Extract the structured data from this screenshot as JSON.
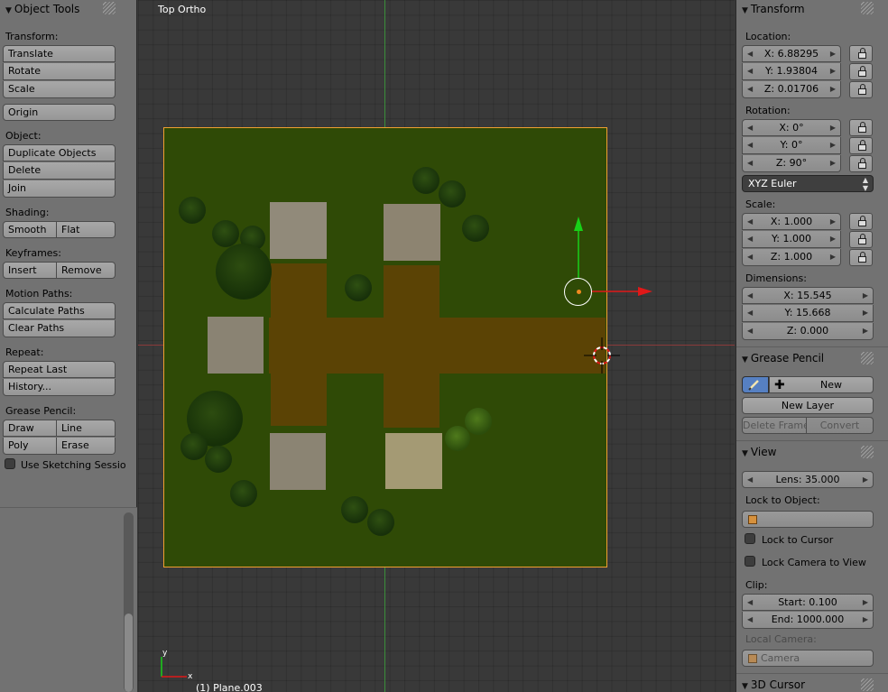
{
  "left_panel": {
    "header": "Object Tools",
    "transform": {
      "label": "Transform:",
      "translate": "Translate",
      "rotate": "Rotate",
      "scale": "Scale"
    },
    "origin": "Origin",
    "object": {
      "label": "Object:",
      "duplicate": "Duplicate Objects",
      "delete": "Delete",
      "join": "Join"
    },
    "shading": {
      "label": "Shading:",
      "smooth": "Smooth",
      "flat": "Flat"
    },
    "keyframes": {
      "label": "Keyframes:",
      "insert": "Insert",
      "remove": "Remove"
    },
    "motion_paths": {
      "label": "Motion Paths:",
      "calculate": "Calculate Paths",
      "clear": "Clear Paths"
    },
    "repeat": {
      "label": "Repeat:",
      "repeat_last": "Repeat Last",
      "history": "History..."
    },
    "grease_pencil": {
      "label": "Grease Pencil:",
      "draw": "Draw",
      "line": "Line",
      "poly": "Poly",
      "erase": "Erase",
      "sketching": "Use Sketching Sessio"
    }
  },
  "viewport": {
    "view_name": "Top Ortho",
    "object_info": "(1) Plane.003",
    "axis_x": "x",
    "axis_y": "y"
  },
  "right_panel": {
    "transform": {
      "header": "Transform",
      "location_label": "Location:",
      "location": {
        "x": "X: 6.88295",
        "y": "Y: 1.93804",
        "z": "Z: 0.01706"
      },
      "rotation_label": "Rotation:",
      "rotation": {
        "x": "X: 0°",
        "y": "Y: 0°",
        "z": "Z: 90°"
      },
      "rotation_mode": "XYZ Euler",
      "scale_label": "Scale:",
      "scale": {
        "x": "X: 1.000",
        "y": "Y: 1.000",
        "z": "Z: 1.000"
      },
      "dimensions_label": "Dimensions:",
      "dimensions": {
        "x": "X: 15.545",
        "y": "Y: 15.668",
        "z": "Z: 0.000"
      }
    },
    "grease_pencil": {
      "header": "Grease Pencil",
      "new": "New",
      "new_layer": "New Layer",
      "delete_frame": "Delete Frame",
      "convert": "Convert"
    },
    "view": {
      "header": "View",
      "lens": "Lens: 35.000",
      "lock_to_object_label": "Lock to Object:",
      "lock_to_cursor": "Lock to Cursor",
      "lock_camera": "Lock Camera to View",
      "clip_label": "Clip:",
      "clip_start": "Start: 0.100",
      "clip_end": "End: 1000.000",
      "local_camera_label": "Local Camera:",
      "camera_placeholder": "Camera"
    },
    "cursor": {
      "header": "3D Cursor"
    }
  },
  "colors": {
    "plane": "#2f4a06",
    "road": "#5b4305",
    "selection_outline": "#f0a030",
    "axis_x": "#e01818",
    "axis_y": "#18d018"
  }
}
